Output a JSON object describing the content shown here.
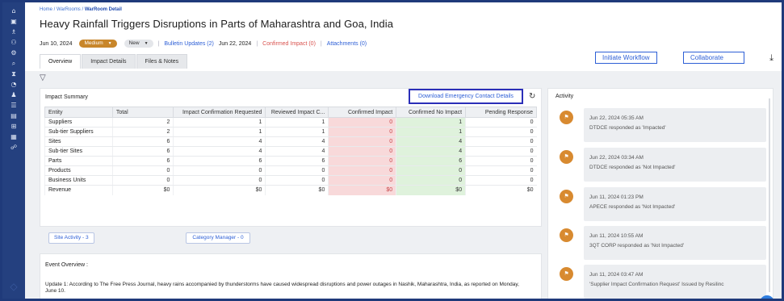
{
  "sidebar": {
    "icons": [
      "home-icon",
      "calendar-icon",
      "people-icon",
      "group-icon",
      "globe-icon",
      "search-icon",
      "hourglass-icon",
      "gauge-icon",
      "person-icon",
      "list-icon",
      "document-icon",
      "network-icon",
      "grid-icon",
      "handshake-icon"
    ],
    "glyphs": [
      "⌂",
      "▣",
      "♗",
      "⚇",
      "⚙",
      "⌕",
      "⧗",
      "◔",
      "♟",
      "☰",
      "▤",
      "⊞",
      "▦",
      "☍"
    ],
    "bottom_glyph": "◇"
  },
  "breadcrumb": {
    "home": "Home",
    "sep": " / ",
    "warrooms": "WarRooms",
    "current": "WarRoom Detail"
  },
  "page_title": "Heavy Rainfall Triggers Disruptions in Parts of Maharashtra and Goa, India",
  "meta": {
    "date": "Jun 10, 2024",
    "severity": "Medium",
    "status": "New",
    "bulletin": "Bulletin Updates (2)",
    "bulletin_date": "Jun 22, 2024",
    "confirmed_impact": "Confirmed Impact (0)",
    "attachments": "Attachments (0)"
  },
  "tabs": [
    "Overview",
    "Impact Details",
    "Files & Notes"
  ],
  "buttons": {
    "initiate": "Initiate Workflow",
    "collaborate": "Collaborate"
  },
  "impact_summary": {
    "title": "Impact Summary",
    "download_label": "Download Emergency Contact Details",
    "columns": [
      "Entity",
      "Total",
      "Impact Confirmation Requested",
      "Reviewed Impact C...",
      "Confirmed Impact",
      "Confirmed No Impact",
      "Pending Response"
    ],
    "rows": [
      [
        "Suppliers",
        "2",
        "1",
        "1",
        "0",
        "1",
        "0"
      ],
      [
        "Sub-tier Suppliers",
        "2",
        "1",
        "1",
        "0",
        "1",
        "0"
      ],
      [
        "Sites",
        "6",
        "4",
        "4",
        "0",
        "4",
        "0"
      ],
      [
        "Sub-tier Sites",
        "6",
        "4",
        "4",
        "0",
        "4",
        "0"
      ],
      [
        "Parts",
        "6",
        "6",
        "6",
        "0",
        "6",
        "0"
      ],
      [
        "Products",
        "0",
        "0",
        "0",
        "0",
        "0",
        "0"
      ],
      [
        "Business Units",
        "0",
        "0",
        "0",
        "0",
        "0",
        "0"
      ],
      [
        "Revenue",
        "$0",
        "$0",
        "$0",
        "$0",
        "$0",
        "$0"
      ]
    ],
    "site_activity": "Site Activity - 3",
    "category_manager": "Category Manager - 0"
  },
  "event_overview": {
    "title": "Event Overview :",
    "text": "Update 1: According to The Free Press Journal, heavy rains accompanied by thunderstorms have caused widespread disruptions and power outages in Nashik, Maharashtra, India, as reported on Monday, June 10."
  },
  "activity": {
    "title": "Activity",
    "items": [
      {
        "time": "Jun 22, 2024 05:35 AM",
        "text": "DTDCE responded as 'Impacted'"
      },
      {
        "time": "Jun 22, 2024 03:34 AM",
        "text": "DTDCE responded as 'Not Impacted'"
      },
      {
        "time": "Jun 11, 2024 01:23 PM",
        "text": "APECE responded as 'Not Impacted'"
      },
      {
        "time": "Jun 11, 2024 10:55 AM",
        "text": "3QT CORP responded as 'Not Impacted'"
      },
      {
        "time": "Jun 11, 2024 03:47 AM",
        "text": "'Supplier Impact Confirmation Request' Issued by Resilinc"
      }
    ]
  },
  "colors": {
    "sidebar": "#24407f",
    "accent": "#2d5fd6",
    "severity": "#c8862a",
    "pink_cell": "#f8d9da",
    "green_cell": "#dff2dc",
    "highlight_border": "#2b2fb8"
  }
}
